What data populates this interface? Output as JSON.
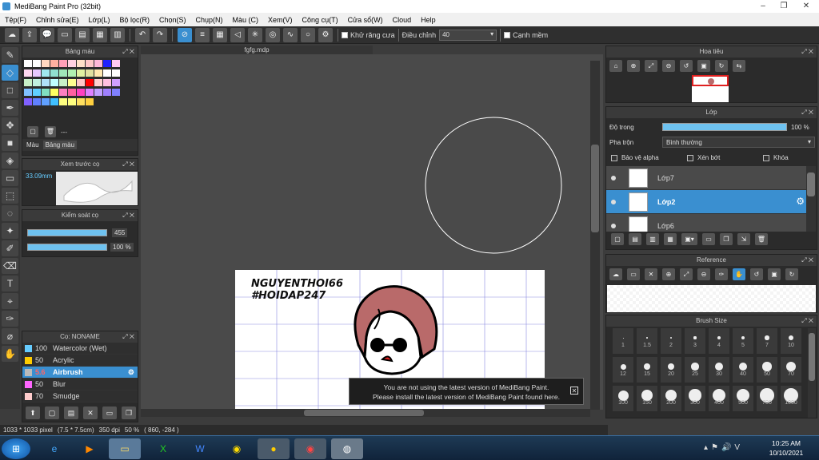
{
  "window": {
    "title": "MediBang Paint Pro (32bit)"
  },
  "menu": [
    "Tệp(F)",
    "Chỉnh sửa(E)",
    "Lớp(L)",
    "Bộ lọc(R)",
    "Chọn(S)",
    "Chụp(N)",
    "Màu (C)",
    "Xem(V)",
    "Công cụ(T)",
    "Cửa sổ(W)",
    "Cloud",
    "Help"
  ],
  "toolbar": {
    "antialias_label": "Khử răng cưa",
    "adjust_label": "Điều chỉnh",
    "adjust_value": "40",
    "sharp_label": "Cạnh mềm"
  },
  "palette_panel": {
    "title": "Bảng màu",
    "count_text": "---",
    "tabs": [
      "Màu",
      "Bảng màu"
    ],
    "colors": [
      "#ffffff",
      "#ffffff",
      "#ffd8c0",
      "#ffb0a0",
      "#ffa0b8",
      "#ffd0e0",
      "#ffe0c8",
      "#ffc8c8",
      "#ffb8d8",
      "#2020ff",
      "#ffc8f0",
      "#ffd8f0",
      "#e8c8ff",
      "#a0e8f0",
      "#90e0d0",
      "#a0e8b8",
      "#b0f0b0",
      "#e0f0a0",
      "#e0e0a0",
      "#ffe8b0",
      "#ffffff",
      "#ffffff",
      "#c8f0c8",
      "#c0f0e0",
      "#b0e0f8",
      "#c0ffff",
      "#c8f0c8",
      "#ffff90",
      "#ffc8c8",
      "#ff0000",
      "#ffd0d0",
      "#ffc0e0",
      "#d0a0ff",
      "#80c0ff",
      "#60d0ff",
      "#80e0c0",
      "#ffff60",
      "#ff80c0",
      "#ff60a0",
      "#ff40c0",
      "#e080ff",
      "#c0a0ff",
      "#a080ff",
      "#8080ff",
      "#8060ff",
      "#6080ff",
      "#60a0ff",
      "#40c0ff",
      "#ffff80",
      "#ffff80",
      "#ffe060",
      "#ffd040"
    ]
  },
  "brush_preview": {
    "title": "Xem trước cọ",
    "size": "33.09mm"
  },
  "brush_control": {
    "title": "Kiểm soát cọ",
    "size_value": "455",
    "opacity_value": "100 %"
  },
  "brush_list": {
    "title": "Cọ: NONAME",
    "items": [
      {
        "size": "100",
        "name": "Watercolor (Wet)",
        "color": "#6cf"
      },
      {
        "size": "50",
        "name": "Acrylic",
        "color": "#fc0"
      },
      {
        "size": "5.6",
        "name": "Airbrush",
        "color": "#bbb"
      },
      {
        "size": "50",
        "name": "Blur",
        "color": "#f6f"
      },
      {
        "size": "70",
        "name": "Smudge",
        "color": "#fcc"
      }
    ]
  },
  "document": {
    "tab": "fgfg.mdp",
    "text1": "NGUYENTHOI66",
    "text2": "#HOIDAP247"
  },
  "notification": {
    "line1": "You are not using the latest version of MediBang Paint.",
    "line2": "Please install the latest version of MediBang Paint found here."
  },
  "navigator": {
    "title": "Hoa tiêu"
  },
  "layers": {
    "title": "Lớp",
    "opacity_label": "Độ trong",
    "opacity_value": "100 %",
    "blend_label": "Pha trộn",
    "blend_value": "Bình thường",
    "opt_alpha": "Bảo vệ alpha",
    "opt_clip": "Xén bớt",
    "opt_lock": "Khóa",
    "items": [
      "Lớp7",
      "Lớp2",
      "Lớp6"
    ]
  },
  "reference": {
    "title": "Reference"
  },
  "brush_size": {
    "title": "Brush Size",
    "sizes": [
      "1",
      "1.5",
      "2",
      "3",
      "4",
      "5",
      "7",
      "10",
      "12",
      "15",
      "20",
      "25",
      "30",
      "40",
      "50",
      "70",
      "100",
      "150",
      "200",
      "300",
      "400",
      "500",
      "700",
      "1000"
    ]
  },
  "status": {
    "dimensions": "1033 * 1033 pixel",
    "physical": "(7.5 * 7.5cm)",
    "dpi": "350 dpi",
    "zoom": "50 %",
    "coords": "( 860, -284 )"
  },
  "taskbar": {
    "time": "10:25 AM",
    "date": "10/10/2021"
  }
}
